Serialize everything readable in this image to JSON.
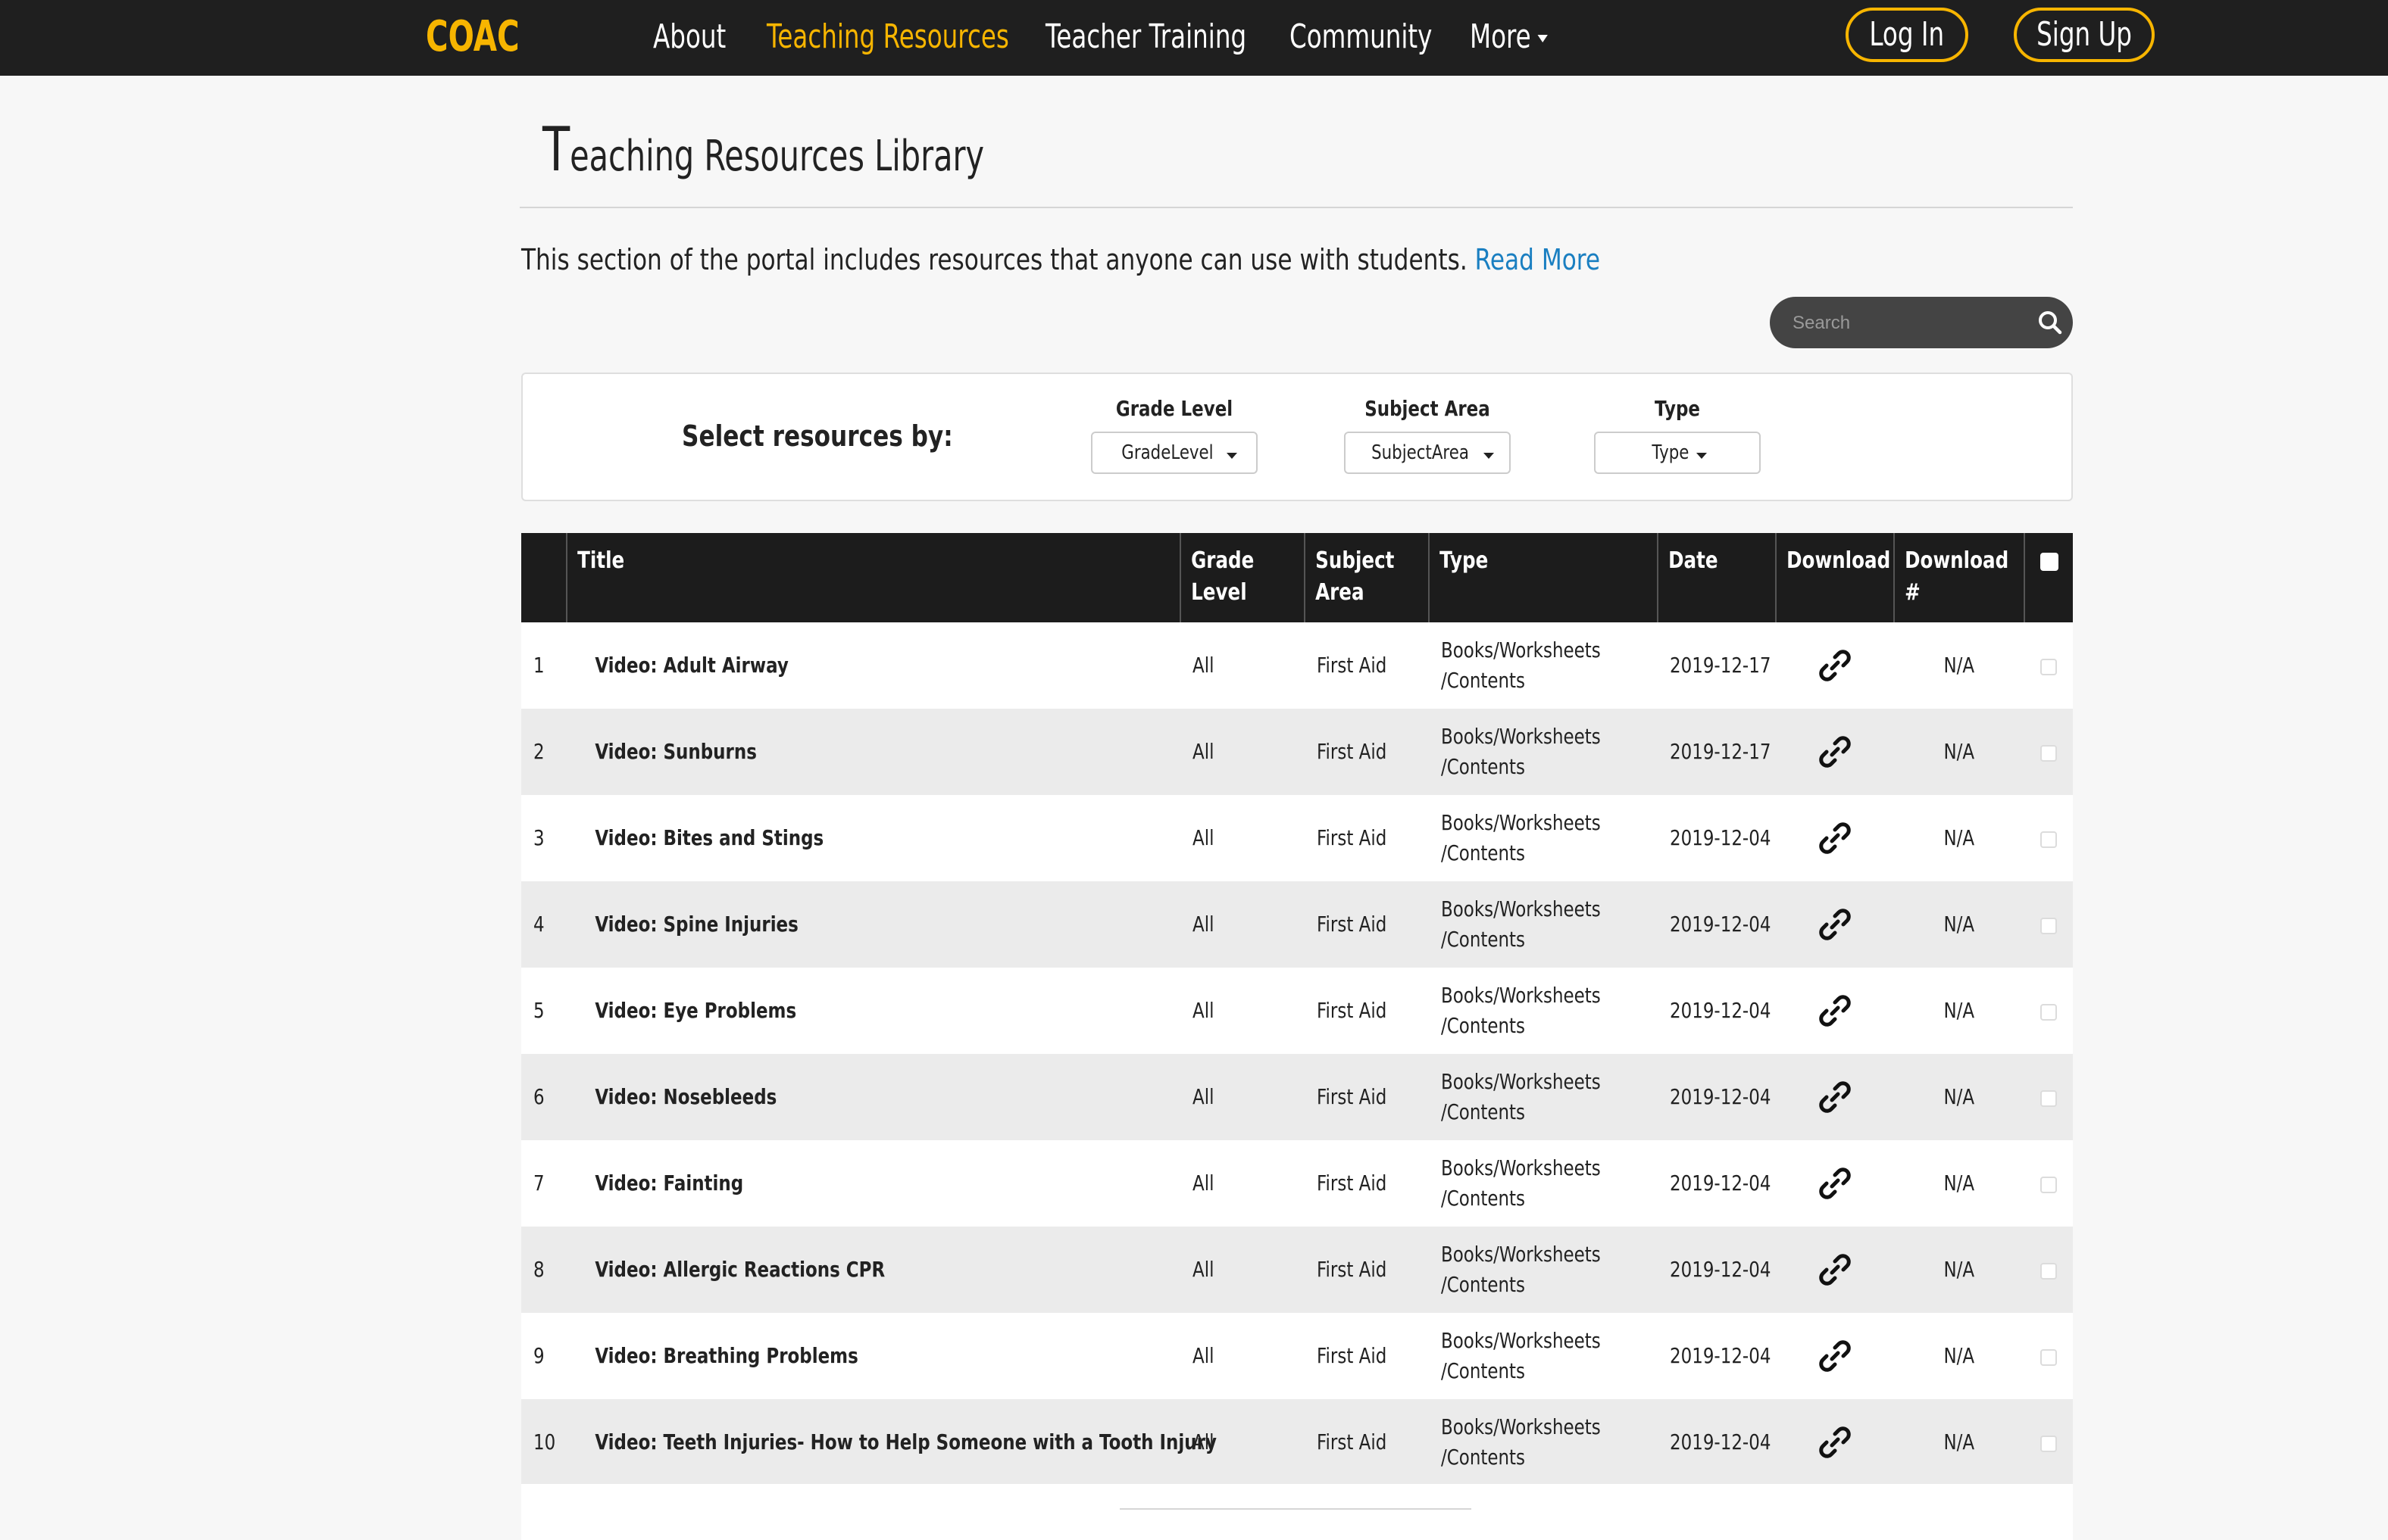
{
  "nav": {
    "brand": "COAC",
    "items": [
      {
        "label": "About",
        "active": false
      },
      {
        "label": "Teaching Resources",
        "active": true
      },
      {
        "label": "Teacher Training",
        "active": false
      },
      {
        "label": "Community",
        "active": false
      },
      {
        "label": "More",
        "active": false,
        "has_caret": true
      }
    ],
    "login": "Log In",
    "signup": "Sign Up",
    "accent_color": "#f7b500",
    "bar_color": "#1f1f1f"
  },
  "page": {
    "title_initial": "T",
    "title_rest": "eaching Resources Library",
    "intro_text": "This section of the portal includes resources that anyone can use with students. ",
    "read_more": "Read More",
    "link_color": "#1a7fc1"
  },
  "search": {
    "placeholder": "Search",
    "icon": "search-icon"
  },
  "filters": {
    "label": "Select resources by:",
    "groups": [
      {
        "label": "Grade Level",
        "selected": "GradeLevel"
      },
      {
        "label": "Subject Area",
        "selected": "SubjectArea"
      },
      {
        "label": "Type",
        "selected": "Type"
      }
    ]
  },
  "table": {
    "columns": [
      "",
      "Title",
      "Grade\nLevel",
      "Subject\nArea",
      "Type",
      "Date",
      "Download",
      "Download\n#",
      ""
    ],
    "download_icon": "link-icon",
    "rows": [
      {
        "num": "1",
        "title": "Video: Adult Airway",
        "grade": "All",
        "subject": "First Aid",
        "type": "Books/Worksheets\n/Contents",
        "date": "2019-12-17",
        "count": "N/A"
      },
      {
        "num": "2",
        "title": "Video: Sunburns",
        "grade": "All",
        "subject": "First Aid",
        "type": "Books/Worksheets\n/Contents",
        "date": "2019-12-17",
        "count": "N/A"
      },
      {
        "num": "3",
        "title": "Video: Bites and Stings",
        "grade": "All",
        "subject": "First Aid",
        "type": "Books/Worksheets\n/Contents",
        "date": "2019-12-04",
        "count": "N/A"
      },
      {
        "num": "4",
        "title": "Video: Spine Injuries",
        "grade": "All",
        "subject": "First Aid",
        "type": "Books/Worksheets\n/Contents",
        "date": "2019-12-04",
        "count": "N/A"
      },
      {
        "num": "5",
        "title": "Video: Eye Problems",
        "grade": "All",
        "subject": "First Aid",
        "type": "Books/Worksheets\n/Contents",
        "date": "2019-12-04",
        "count": "N/A"
      },
      {
        "num": "6",
        "title": "Video: Nosebleeds",
        "grade": "All",
        "subject": "First Aid",
        "type": "Books/Worksheets\n/Contents",
        "date": "2019-12-04",
        "count": "N/A"
      },
      {
        "num": "7",
        "title": "Video: Fainting",
        "grade": "All",
        "subject": "First Aid",
        "type": "Books/Worksheets\n/Contents",
        "date": "2019-12-04",
        "count": "N/A"
      },
      {
        "num": "8",
        "title": "Video: Allergic Reactions CPR",
        "grade": "All",
        "subject": "First Aid",
        "type": "Books/Worksheets\n/Contents",
        "date": "2019-12-04",
        "count": "N/A"
      },
      {
        "num": "9",
        "title": "Video: Breathing Problems",
        "grade": "All",
        "subject": "First Aid",
        "type": "Books/Worksheets\n/Contents",
        "date": "2019-12-04",
        "count": "N/A"
      },
      {
        "num": "10",
        "title": "Video: Teeth Injuries- How to Help Someone with a Tooth Injury",
        "grade": "All",
        "subject": "First Aid",
        "type": "Books/Worksheets\n/Contents",
        "date": "2019-12-04",
        "count": "N/A"
      }
    ]
  }
}
